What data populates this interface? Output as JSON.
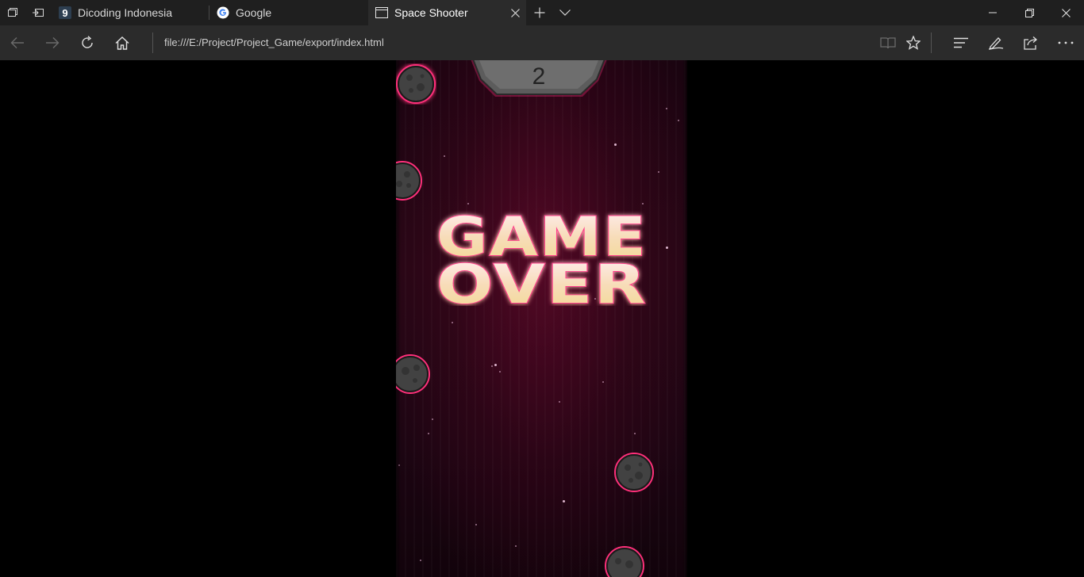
{
  "browser": {
    "tabs": [
      {
        "title": "Dicoding Indonesia",
        "favicon": "dicoding-icon",
        "active": false
      },
      {
        "title": "Google",
        "favicon": "google-icon",
        "active": false
      },
      {
        "title": "Space Shooter",
        "favicon": "page-icon",
        "active": true
      }
    ],
    "address": "file:///E:/Project/Project_Game/export/index.html",
    "toolbar_icons": [
      "reading-view-icon",
      "favorites-star-icon",
      "hub-icon",
      "web-note-icon",
      "share-icon",
      "more-icon"
    ],
    "accent": "#2b2b2b"
  },
  "game": {
    "score": "2",
    "game_over_line1": "GAME",
    "game_over_line2": "OVER",
    "colors": {
      "glow": "#ff3d8a",
      "text_top": "#ffe8ee",
      "text_bottom": "#f1d98f",
      "background": "#260615"
    }
  }
}
